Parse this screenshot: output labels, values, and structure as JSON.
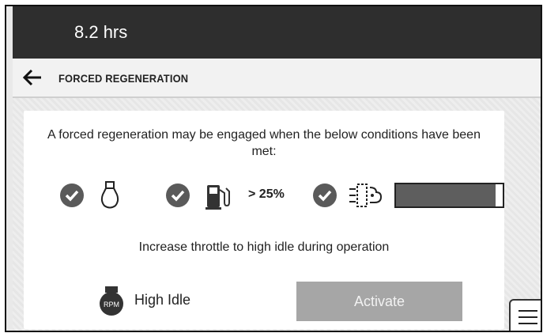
{
  "status_bar": {
    "hours": "8.2 hrs"
  },
  "header": {
    "title": "FORCED REGENERATION",
    "back_icon": "arrow-left-icon"
  },
  "main": {
    "message": "A forced regeneration may be engaged when the below conditions have been met:",
    "conditions": [
      {
        "name": "engine-coolant",
        "met": true,
        "icon": "coolant-tank-icon"
      },
      {
        "name": "fuel-level",
        "met": true,
        "icon": "fuel-pump-icon",
        "value_label": "> 25%"
      },
      {
        "name": "exhaust",
        "met": true,
        "icon": "exhaust-filter-icon",
        "level_fraction": 0.93
      }
    ],
    "instruction": "Increase throttle to high idle during operation",
    "idle_icon_label": "RPM",
    "idle_label": "High Idle",
    "activate_label": "Activate"
  },
  "colors": {
    "status_bar": "#2e2e2e",
    "check": "#5a5a5a",
    "activate_disabled": "#a6a6a6",
    "bar_fill": "#5e5e5e"
  }
}
